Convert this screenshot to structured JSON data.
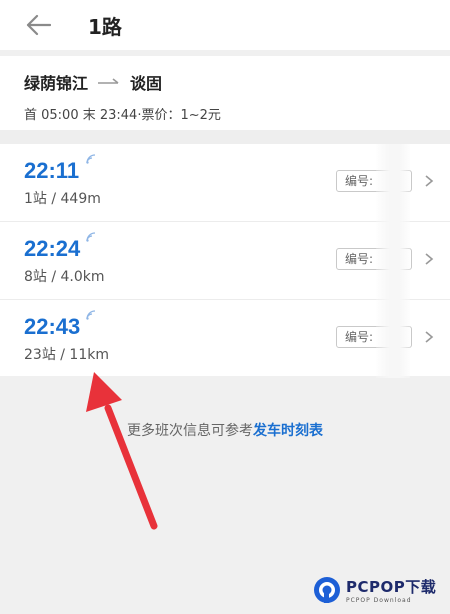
{
  "header": {
    "title": "1路"
  },
  "route": {
    "from": "绿荫锦江",
    "to": "谈固",
    "meta": "首 05:00 末 23:44·票价：1~2元"
  },
  "buses": [
    {
      "time": "22:11",
      "stops": "1站 / 449m",
      "plate": "编号:"
    },
    {
      "time": "22:24",
      "stops": "8站 / 4.0km",
      "plate": "编号:"
    },
    {
      "time": "22:43",
      "stops": "23站 / 11km",
      "plate": "编号:"
    }
  ],
  "footer": {
    "note": "更多班次信息可参考",
    "link": "发车时刻表"
  },
  "watermark": {
    "main": "PCPOP下载",
    "sub": "PCPOP Download"
  },
  "colors": {
    "accent": "#1a6fd0",
    "annotation": "#e8323a"
  }
}
